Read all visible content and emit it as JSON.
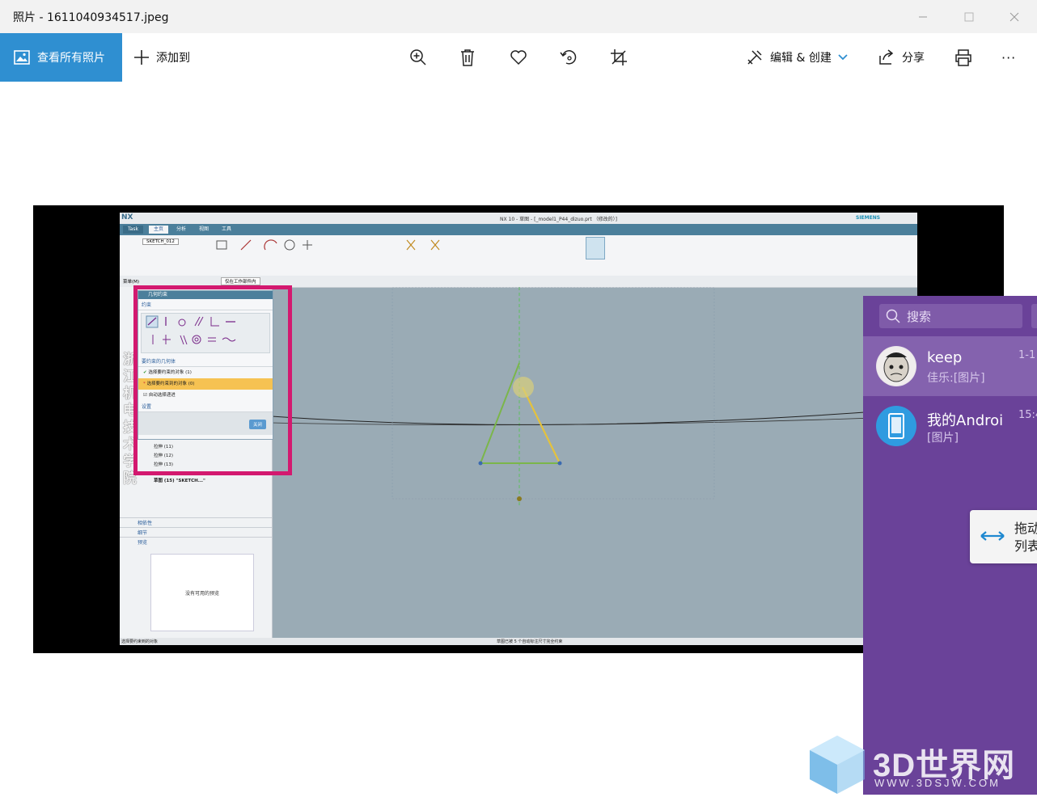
{
  "window": {
    "title": "照片 - 1611040934517.jpeg"
  },
  "toolbar": {
    "view_all_label": "查看所有照片",
    "add_to_label": "添加到",
    "edit_create_label": "编辑 & 创建",
    "share_label": "分享",
    "more_label": "···"
  },
  "nx": {
    "logo": "NX",
    "title": "NX 10 - 草图 - [_model1_P44_dizuo.prt （修改的）]",
    "brand": "SIEMENS",
    "tabs": [
      "Task",
      "主页",
      "分析",
      "视图",
      "工具"
    ],
    "sketch_name": "SKETCH_012",
    "filter": "仅在工作部件内",
    "menu": "菜单(M)",
    "dialog": {
      "title": "几何约束",
      "section_constraint": "约束",
      "section_geometry": "要约束的几何体",
      "row_select_object": "选择要约束的对象 (1)",
      "row_select_target": "选择要约束到的对象 (0)",
      "row_auto": "自动选择递进",
      "section_settings": "设置",
      "close_button": "关闭"
    },
    "tree_rows": [
      "拉伸 (11)",
      "拉伸 (12)",
      "拉伸 (13)",
      "草图 (15) \"SKETCH...\""
    ],
    "side_sections": [
      "相依性",
      "细节",
      "预览"
    ],
    "preview_text": "没有可用的预览",
    "status_left": "选择要约束到的对象",
    "status_center": "草图已被 5 个自动标注尺寸完全约束",
    "left_vertical_text": "浙江机电技术学院"
  },
  "chat": {
    "search_placeholder": "搜索",
    "items": [
      {
        "name": "keep",
        "message": "佳乐:[图片]",
        "time": "1-1"
      },
      {
        "name": "我的Androi",
        "message": "[图片]",
        "time": "15:4"
      }
    ],
    "tip": "拖动\n列表"
  },
  "watermark": {
    "text": "3D世界网",
    "url": "WWW.3DSJW.COM"
  },
  "colors": {
    "accent": "#2f8fd1",
    "chat_bg": "#6a4299",
    "highlight": "#d3196f"
  }
}
